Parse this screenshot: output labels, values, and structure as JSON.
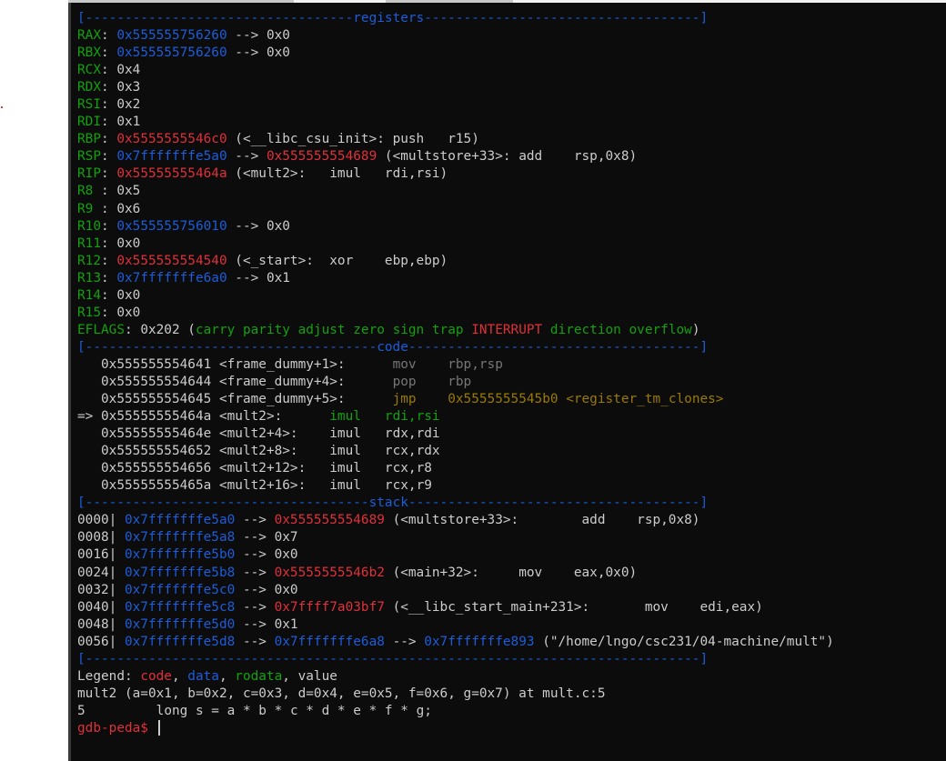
{
  "colors": {
    "background": "#0c0c0c",
    "text": "#cccccc",
    "green": "#13a10e",
    "blue": "#1d5cda",
    "red": "#e0303a",
    "gray": "#767676",
    "yellow": "#9a7a00"
  },
  "sections": {
    "registers_header_left": "[----------------------------------",
    "registers_title": "registers",
    "registers_header_right": "-----------------------------------]",
    "code_header_left": "[-------------------------------------",
    "code_title": "code",
    "code_header_right": "-------------------------------------]",
    "stack_header_left": "[------------------------------------",
    "stack_title": "stack",
    "stack_header_right": "-------------------------------------]",
    "footer_rule": "[------------------------------------------------------------------------------]"
  },
  "registers": [
    {
      "name": "RAX",
      "sep": ": ",
      "value": "0x555555756260",
      "value_color": "blue",
      "rest": " --> 0x0"
    },
    {
      "name": "RBX",
      "sep": ": ",
      "value": "0x555555756260",
      "value_color": "blue",
      "rest": " --> 0x0"
    },
    {
      "name": "RCX",
      "sep": ": ",
      "value": "0x4",
      "value_color": "white",
      "rest": ""
    },
    {
      "name": "RDX",
      "sep": ": ",
      "value": "0x3",
      "value_color": "white",
      "rest": ""
    },
    {
      "name": "RSI",
      "sep": ": ",
      "value": "0x2",
      "value_color": "white",
      "rest": ""
    },
    {
      "name": "RDI",
      "sep": ": ",
      "value": "0x1",
      "value_color": "white",
      "rest": ""
    },
    {
      "name": "RBP",
      "sep": ": ",
      "value": "0x5555555546c0",
      "value_color": "red",
      "rest": " (<__libc_csu_init>: push   r15)"
    },
    {
      "name": "RSP",
      "sep": ": ",
      "value": "0x7fffffffe5a0",
      "value_color": "blue",
      "arrow": " --> ",
      "value2": "0x555555554689",
      "value2_color": "red",
      "rest": " (<multstore+33>: add    rsp,0x8)"
    },
    {
      "name": "RIP",
      "sep": ": ",
      "value": "0x55555555464a",
      "value_color": "red",
      "rest": " (<mult2>:   imul   rdi,rsi)"
    },
    {
      "name": "R8",
      "sep": " : ",
      "value": "0x5",
      "value_color": "white",
      "rest": ""
    },
    {
      "name": "R9",
      "sep": " : ",
      "value": "0x6",
      "value_color": "white",
      "rest": ""
    },
    {
      "name": "R10",
      "sep": ": ",
      "value": "0x555555756010",
      "value_color": "blue",
      "rest": " --> 0x0"
    },
    {
      "name": "R11",
      "sep": ": ",
      "value": "0x0",
      "value_color": "white",
      "rest": ""
    },
    {
      "name": "R12",
      "sep": ": ",
      "value": "0x555555554540",
      "value_color": "red",
      "rest": " (<_start>:  xor    ebp,ebp)"
    },
    {
      "name": "R13",
      "sep": ": ",
      "value": "0x7fffffffe6a0",
      "value_color": "blue",
      "rest": " --> 0x1"
    },
    {
      "name": "R14",
      "sep": ": ",
      "value": "0x0",
      "value_color": "white",
      "rest": ""
    },
    {
      "name": "R15",
      "sep": ": ",
      "value": "0x0",
      "value_color": "white",
      "rest": ""
    }
  ],
  "eflags": {
    "name": "EFLAGS",
    "sep": ": ",
    "value": "0x202",
    "open": " (",
    "flags_low": "carry parity adjust zero sign trap",
    "flag_set": "INTERRUPT",
    "flags_high": "direction overflow",
    "close": ")"
  },
  "code": [
    {
      "prefix": "   ",
      "addr": "0x555555554641",
      "sym": " <frame_dummy+1>:      ",
      "mnemonic": "mov    ",
      "operands": "rbp,rsp",
      "style": "gray"
    },
    {
      "prefix": "   ",
      "addr": "0x555555554644",
      "sym": " <frame_dummy+4>:      ",
      "mnemonic": "pop    ",
      "operands": "rbp",
      "style": "gray"
    },
    {
      "prefix": "   ",
      "addr": "0x555555554645",
      "sym": " <frame_dummy+5>:      ",
      "mnemonic": "jmp    ",
      "operands": "0x5555555545b0 <register_tm_clones>",
      "style": "yellow"
    },
    {
      "prefix": "=> ",
      "addr": "0x55555555464a",
      "sym": " <mult2>:      ",
      "mnemonic": "imul   ",
      "operands": "rdi,rsi",
      "style": "green"
    },
    {
      "prefix": "   ",
      "addr": "0x55555555464e",
      "sym": " <mult2+4>:    ",
      "mnemonic": "imul   ",
      "operands": "rdx,rdi",
      "style": "white"
    },
    {
      "prefix": "   ",
      "addr": "0x555555554652",
      "sym": " <mult2+8>:    ",
      "mnemonic": "imul   ",
      "operands": "rcx,rdx",
      "style": "white"
    },
    {
      "prefix": "   ",
      "addr": "0x555555554656",
      "sym": " <mult2+12>:   ",
      "mnemonic": "imul   ",
      "operands": "rcx,r8",
      "style": "white"
    },
    {
      "prefix": "   ",
      "addr": "0x55555555465a",
      "sym": " <mult2+16>:   ",
      "mnemonic": "imul   ",
      "operands": "rcx,r9",
      "style": "white"
    }
  ],
  "stack": [
    {
      "offset": "0000| ",
      "addr": "0x7fffffffe5a0",
      "arrow": " --> ",
      "val": "0x555555554689",
      "val_color": "red",
      "rest": " (<multstore+33>:        add    rsp,0x8)"
    },
    {
      "offset": "0008| ",
      "addr": "0x7fffffffe5a8",
      "arrow": " --> ",
      "val": "0x7",
      "val_color": "white",
      "rest": ""
    },
    {
      "offset": "0016| ",
      "addr": "0x7fffffffe5b0",
      "arrow": " --> ",
      "val": "0x0",
      "val_color": "white",
      "rest": ""
    },
    {
      "offset": "0024| ",
      "addr": "0x7fffffffe5b8",
      "arrow": " --> ",
      "val": "0x5555555546b2",
      "val_color": "red",
      "rest": " (<main+32>:     mov    eax,0x0)"
    },
    {
      "offset": "0032| ",
      "addr": "0x7fffffffe5c0",
      "arrow": " --> ",
      "val": "0x0",
      "val_color": "white",
      "rest": ""
    },
    {
      "offset": "0040| ",
      "addr": "0x7fffffffe5c8",
      "arrow": " --> ",
      "val": "0x7ffff7a03bf7",
      "val_color": "red",
      "rest": " (<__libc_start_main+231>:       mov    edi,eax)"
    },
    {
      "offset": "0048| ",
      "addr": "0x7fffffffe5d0",
      "arrow": " --> ",
      "val": "0x1",
      "val_color": "white",
      "rest": ""
    },
    {
      "offset": "0056| ",
      "addr": "0x7fffffffe5d8",
      "arrow": " --> ",
      "val": "0x7fffffffe6a8",
      "val_color": "blue",
      "arrow2": " --> ",
      "val2": "0x7fffffffe893",
      "val2_color": "blue",
      "rest": " (\"/home/lngo/csc231/04-machine/mult\")"
    }
  ],
  "legend": {
    "label": "Legend: ",
    "code": "code",
    "sep1": ", ",
    "data": "data",
    "sep2": ", ",
    "rodata": "rodata",
    "sep3": ", ",
    "value": "value"
  },
  "frame_line": "mult2 (a=0x1, b=0x2, c=0x3, d=0x4, e=0x5, f=0x6, g=0x7) at mult.c:5",
  "source_line": {
    "number": "5",
    "gap": "         ",
    "code": "long s = a * b * c * d * e * f * g;"
  },
  "prompt": {
    "text": "gdb-peda$ ",
    "input": ""
  }
}
